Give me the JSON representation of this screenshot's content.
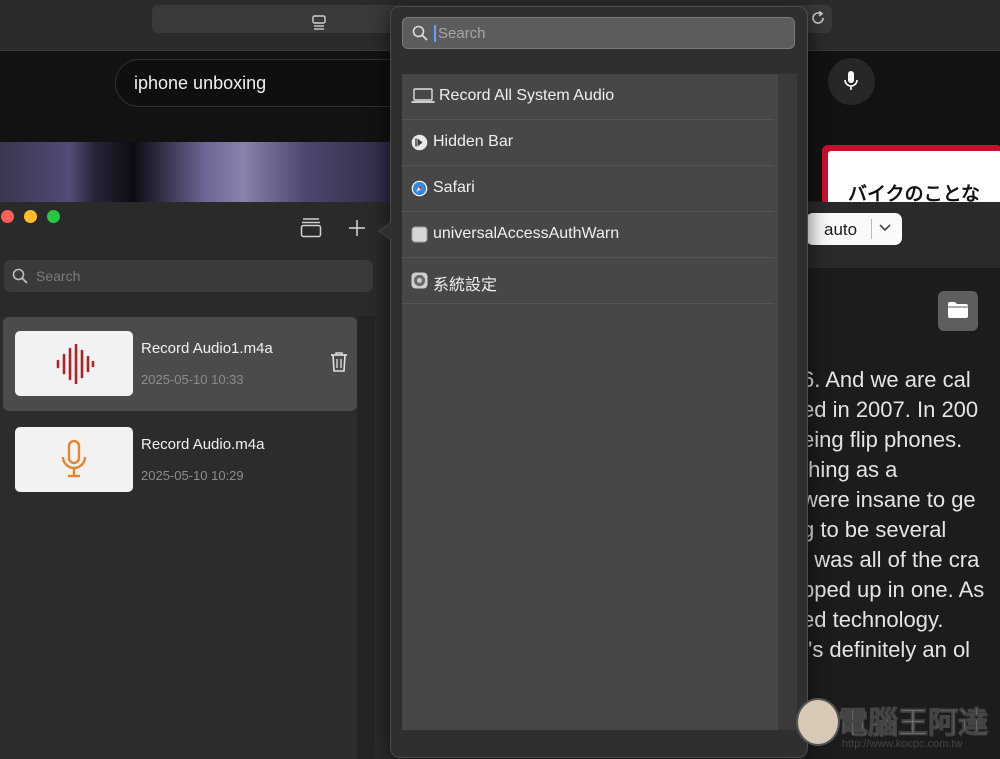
{
  "browser": {
    "search_query": "iphone unboxing",
    "promo_text": "バイクのことな"
  },
  "app": {
    "search_placeholder": "Search",
    "language_select": "auto",
    "recordings": [
      {
        "name": "Record Audio1.m4a",
        "date": "2025-05-10 10:33",
        "icon": "waveform-icon",
        "icon_color": "#b22222",
        "selected": true
      },
      {
        "name": "Record Audio.m4a",
        "date": "2025-05-10 10:29",
        "icon": "microphone-icon",
        "icon_color": "#e8842c",
        "selected": false
      }
    ],
    "transcript_lines": [
      "6. And we are cal",
      "ed in 2007. In 200",
      "eing flip phones.",
      " thing as a",
      "were insane to ge",
      "g to be several",
      "t was all of the cra",
      "pped up in one. As",
      "ed technology.",
      "t's definitely an ol"
    ]
  },
  "popover": {
    "search_placeholder": "Search",
    "sources": [
      {
        "label": "Record All System Audio",
        "icon": "laptop-icon"
      },
      {
        "label": "Hidden Bar",
        "icon": "hidden-bar-icon"
      },
      {
        "label": "Safari",
        "icon": "safari-icon"
      },
      {
        "label": "universalAccessAuthWarn",
        "icon": "generic-app-icon"
      },
      {
        "label": "系統設定",
        "icon": "system-settings-icon"
      }
    ]
  },
  "watermark": {
    "title": "電腦王阿達",
    "url": "http://www.kocpc.com.tw"
  },
  "colors": {
    "accent_blue": "#5ea3ff",
    "waveform_red": "#b22222",
    "mic_orange": "#e8842c"
  }
}
